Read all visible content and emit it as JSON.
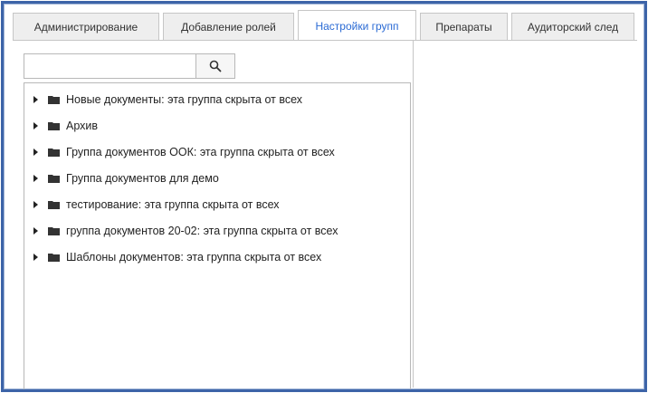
{
  "tabs": [
    {
      "label": "Администрирование",
      "active": false
    },
    {
      "label": "Добавление ролей",
      "active": false
    },
    {
      "label": "Настройки групп",
      "active": true
    },
    {
      "label": "Препараты",
      "active": false
    },
    {
      "label": "Аудиторский след",
      "active": false
    }
  ],
  "search": {
    "value": "",
    "button_icon": "search-icon"
  },
  "tree": {
    "items": [
      {
        "label": "Новые документы: эта группа скрыта от всех",
        "icon": "folder-icon"
      },
      {
        "label": "Архив",
        "icon": "folder-icon"
      },
      {
        "label": "Группа документов ООК: эта группа скрыта от всех",
        "icon": "folder-icon"
      },
      {
        "label": "Группа документов для демо",
        "icon": "folder-icon"
      },
      {
        "label": "тестирование: эта группа скрыта от всех",
        "icon": "folder-icon"
      },
      {
        "label": "группа документов 20-02: эта группа скрыта от всех",
        "icon": "folder-icon"
      },
      {
        "label": "Шаблоны документов: эта группа скрыта от всех",
        "icon": "folder-icon"
      }
    ]
  },
  "colors": {
    "frame_border": "#3d64a8",
    "active_tab_text": "#2a6ad4",
    "tab_background": "#eeeeee"
  }
}
